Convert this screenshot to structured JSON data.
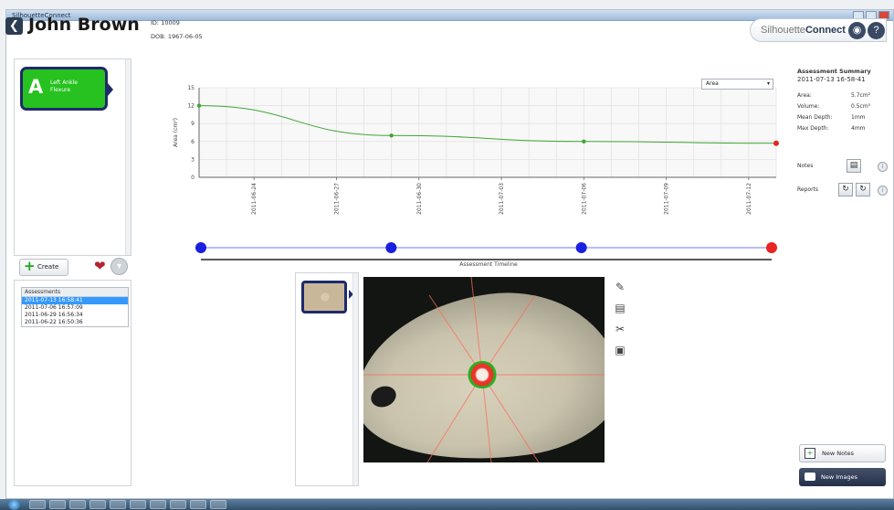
{
  "window": {
    "title": "SilhouetteConnect"
  },
  "patient": {
    "name": "John Brown",
    "id_line": "ID: 10009",
    "dob_line": "DOB: 1967-06-05"
  },
  "brand": {
    "text_light": "Silhouette",
    "text_bold": "Connect"
  },
  "wound": {
    "letter": "A",
    "label_line1": "Left Ankle",
    "label_line2": "Flexure"
  },
  "buttons": {
    "create": "Create",
    "new_notes": "New Notes",
    "new_images": "New Images"
  },
  "assessments": {
    "header": "Assessments",
    "items": [
      "2011-07-13 16:58:41",
      "2011-07-06 16:57:09",
      "2011-06-29 16:56:34",
      "2011-06-22 16:50:36"
    ],
    "selected_index": 0
  },
  "metric_select": {
    "value": "Area"
  },
  "chart_data": {
    "type": "line",
    "x": [
      "2011-06-22",
      "2011-06-29",
      "2011-07-06",
      "2011-07-13"
    ],
    "series": [
      {
        "values": [
          12.0,
          7.0,
          6.0,
          5.7
        ]
      }
    ],
    "title": "",
    "xlabel": "",
    "ylabel": "Area (cm²)",
    "ylim": [
      0,
      15
    ],
    "yticks": [
      0,
      3,
      6,
      9,
      12,
      15
    ],
    "xticks": [
      "2011-06-24",
      "2011-06-27",
      "2011-06-30",
      "2011-07-03",
      "2011-07-06",
      "2011-07-09",
      "2011-07-12"
    ],
    "xlim": [
      "2011-06-22",
      "2011-07-13"
    ],
    "grid": true,
    "colors": {
      "line": "#3fa535",
      "latest_point": "#e82424"
    }
  },
  "timeline": {
    "label": "Assessment Timeline",
    "points": [
      0,
      1,
      2,
      3
    ],
    "colors": {
      "point": "#1a1fe0",
      "selected": "#e82424",
      "track": "#b7bdf5"
    }
  },
  "summary": {
    "title": "Assessment Summary",
    "date": "2011-07-13 16-58-41",
    "rows": [
      {
        "label": "Area:",
        "value": "5.7cm²"
      },
      {
        "label": "Volume:",
        "value": "0.5cm³"
      },
      {
        "label": "Mean Depth:",
        "value": "1mm"
      },
      {
        "label": "Max Depth:",
        "value": "4mm"
      }
    ],
    "notes_label": "Notes",
    "reports_label": "Reports"
  },
  "colors": {
    "accent": "#1f2a6b",
    "wound_tile": "#27c21f"
  },
  "icons": {
    "back": "back-arrow-icon",
    "lock": "lock-icon",
    "help": "help-icon",
    "heart": "heart-icon",
    "shield": "shield-icon",
    "tools": [
      "pencil-icon",
      "measure-icon",
      "scissors-icon",
      "export-icon"
    ]
  }
}
